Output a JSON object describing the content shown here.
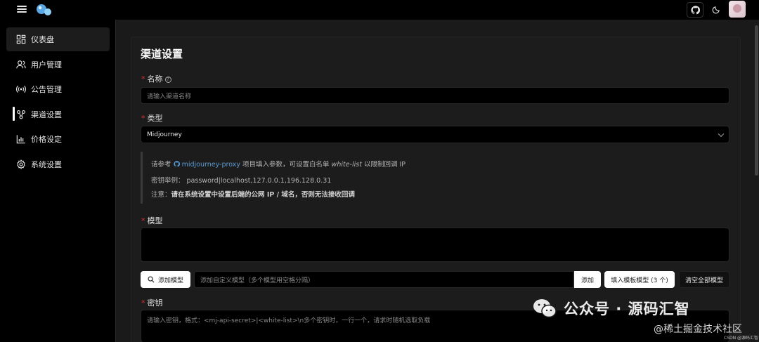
{
  "sidebar": {
    "items": [
      {
        "label": "仪表盘",
        "icon": "dashboard-icon"
      },
      {
        "label": "用户管理",
        "icon": "users-icon"
      },
      {
        "label": "公告管理",
        "icon": "broadcast-icon"
      },
      {
        "label": "渠道设置",
        "icon": "channel-icon"
      },
      {
        "label": "价格设定",
        "icon": "chart-icon"
      },
      {
        "label": "系统设置",
        "icon": "gear-icon"
      }
    ]
  },
  "page": {
    "title": "渠道设置"
  },
  "form": {
    "name_label": "名称",
    "name_help": "?",
    "name_placeholder": "请输入渠道名称",
    "type_label": "类型",
    "type_value": "Midjourney",
    "notice": {
      "line1_prefix": "请参考",
      "line1_link": "midjourney-proxy",
      "line1_mid": "项目填入参数，可设置白名单",
      "line1_em": "white-list",
      "line1_suffix": "以限制回调 IP",
      "line2_label": "密钥举例：",
      "line2_value": "password|localhost,127.0.0.1,196.128.0.31",
      "line3_prefix": "注意：",
      "line3_bold": "请在系统设置中设置后端的公网 IP / 域名，否则无法接收回调"
    },
    "model_label": "模型",
    "add_model_label": "添加模型",
    "custom_model_placeholder": "添加自定义模型（多个模型用空格分隔）",
    "add_label": "添加",
    "fill_template_label": "填入模板模型 (3 个)",
    "clear_all_label": "清空全部模型",
    "key_label": "密钥",
    "key_placeholder": "请输入密钥，格式：<mj-api-secret>|<white-list>\\n多个密钥时，一行一个，请求时随机选取负载"
  },
  "watermark": {
    "main": "公众号 · 源码汇智",
    "secondary": "@稀土掘金技术社区",
    "tiny": "CSDN @源码汇智"
  }
}
